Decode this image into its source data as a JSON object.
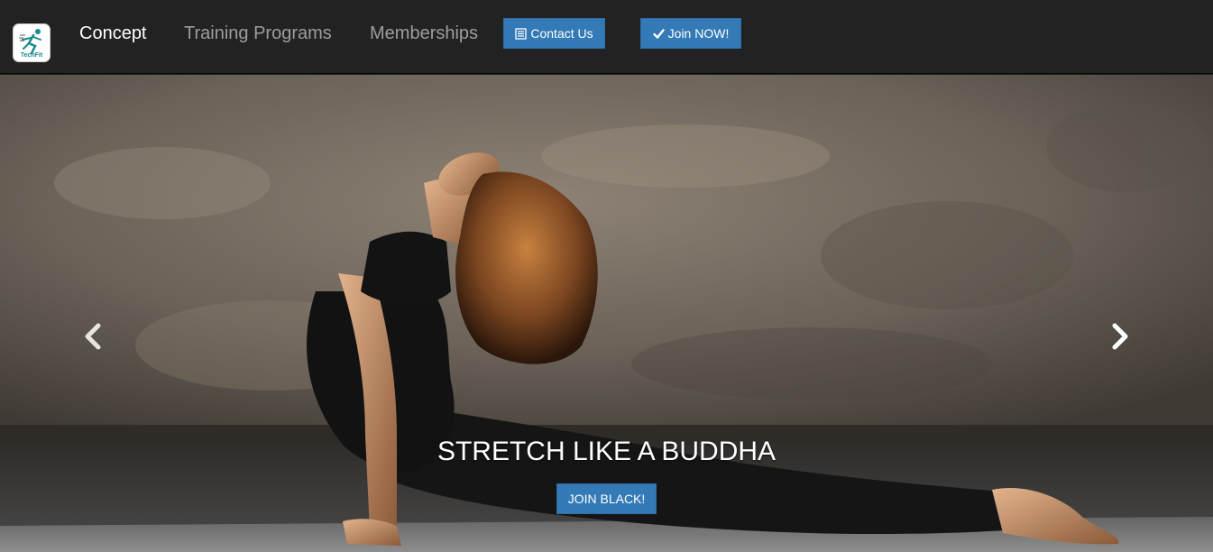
{
  "brand": {
    "logo_text": "TechFit",
    "logo_accent": "#1a8a8f"
  },
  "nav": {
    "items": [
      {
        "label": "Concept",
        "active": true
      },
      {
        "label": "Training Programs",
        "active": false
      },
      {
        "label": "Memberships",
        "active": false
      }
    ],
    "contact_label": "Contact Us",
    "contact_icon": "list-alt-icon",
    "join_label": "Join NOW!",
    "join_icon": "checkmark-icon"
  },
  "hero": {
    "caption": "STRETCH LIKE A BUDDHA",
    "cta_label": "JOIN BLACK!",
    "image_subject": "woman-yoga-upward-dog"
  },
  "colors": {
    "navbar_bg": "#222222",
    "nav_active": "#ffffff",
    "nav_inactive": "#9d9d9d",
    "button_primary": "#337ab7"
  }
}
